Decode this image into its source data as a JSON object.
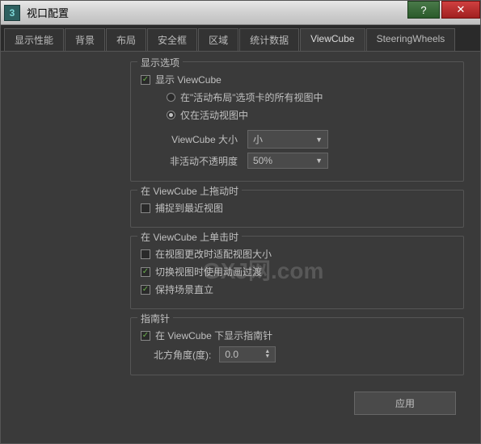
{
  "window": {
    "title": "视口配置"
  },
  "titlebar": {
    "help": "?",
    "close": "✕"
  },
  "tabs": [
    {
      "label": "显示性能"
    },
    {
      "label": "背景"
    },
    {
      "label": "布局"
    },
    {
      "label": "安全框"
    },
    {
      "label": "区域"
    },
    {
      "label": "统计数据"
    },
    {
      "label": "ViewCube"
    },
    {
      "label": "SteeringWheels"
    }
  ],
  "display_options": {
    "title": "显示选项",
    "show_viewcube": "显示 ViewCube",
    "in_all_views": "在\"活动布局\"选项卡的所有视图中",
    "only_active": "仅在活动视图中",
    "size_label": "ViewCube 大小",
    "size_value": "小",
    "opacity_label": "非活动不透明度",
    "opacity_value": "50%"
  },
  "drag_options": {
    "title": "在 ViewCube 上拖动时",
    "snap": "捕捉到最近视图"
  },
  "click_options": {
    "title": "在 ViewCube 上单击时",
    "fit_view": "在视图更改时适配视图大小",
    "animate": "切换视图时使用动画过渡",
    "keep_upright": "保持场景直立"
  },
  "compass": {
    "title": "指南针",
    "show": "在 ViewCube 下显示指南针",
    "north_label": "北方角度(度):",
    "north_value": "0.0"
  },
  "footer": {
    "apply": "应用"
  },
  "watermark": "GXJ网.com"
}
